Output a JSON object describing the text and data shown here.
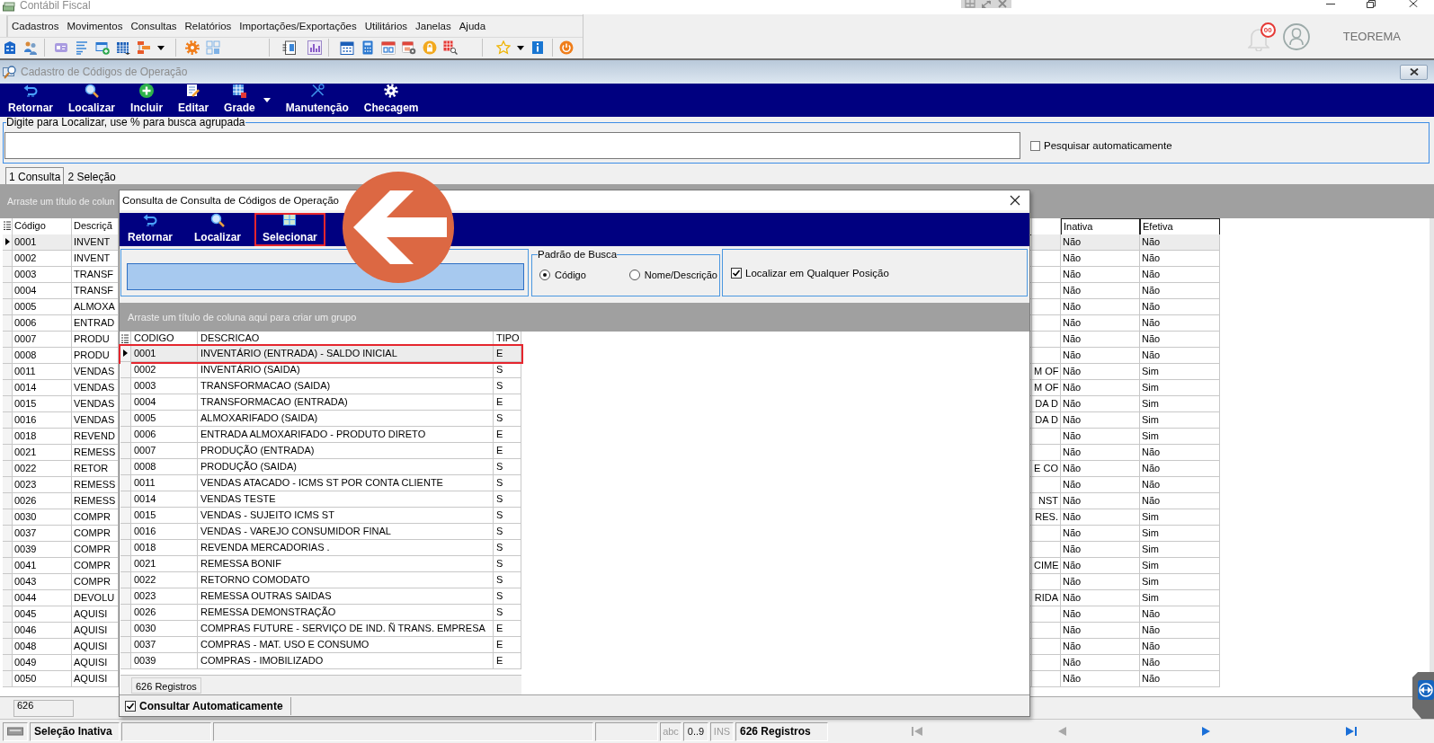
{
  "window": {
    "title": "Contábil Fiscal"
  },
  "menu": [
    "Cadastros",
    "Movimentos",
    "Consultas",
    "Relatórios",
    "Importações/Exportações",
    "Utilitários",
    "Janelas",
    "Ajuda"
  ],
  "user_area": {
    "notification_count": "00",
    "user_name": "TEOREMA"
  },
  "child_window": {
    "title": "Cadastro de Códigos de Operação",
    "toolbar": [
      {
        "label": "Retornar",
        "has_menu": false
      },
      {
        "label": "Localizar",
        "has_menu": false
      },
      {
        "label": "Incluir",
        "has_menu": false
      },
      {
        "label": "Editar",
        "has_menu": false
      },
      {
        "label": "Grade",
        "has_menu": true
      },
      {
        "label": "Manutenção",
        "has_menu": false
      },
      {
        "label": "Checagem",
        "has_menu": false
      }
    ],
    "search": {
      "legend": "Digite para Localizar, use % para busca agrupada"
    },
    "auto_search": {
      "label": "Pesquisar automaticamente",
      "checked": false
    },
    "tabs": [
      {
        "label": "1 Consulta",
        "selected": true
      },
      {
        "label": "2 Seleção",
        "selected": false
      }
    ],
    "group_hint": "Arraste um título de colun",
    "table": {
      "columns": [
        "Código",
        "Descriçã",
        "Inativa",
        "Efetiva"
      ],
      "rows": [
        {
          "codigo": "0001",
          "descricao": "INVENT",
          "inativa": "Não",
          "efetiva": "Não",
          "selected": true
        },
        {
          "codigo": "0002",
          "descricao": "INVENT",
          "inativa": "Não",
          "efetiva": "Não",
          "selected": false
        },
        {
          "codigo": "0003",
          "descricao": "TRANSF",
          "inativa": "Não",
          "efetiva": "Não",
          "selected": false
        },
        {
          "codigo": "0004",
          "descricao": "TRANSF",
          "inativa": "Não",
          "efetiva": "Não",
          "selected": false
        },
        {
          "codigo": "0005",
          "descricao": "ALMOXA",
          "inativa": "Não",
          "efetiva": "Não",
          "selected": false
        },
        {
          "codigo": "0006",
          "descricao": "ENTRAD",
          "inativa": "Não",
          "efetiva": "Não",
          "selected": false
        },
        {
          "codigo": "0007",
          "descricao": "PRODU",
          "inativa": "Não",
          "efetiva": "Não",
          "selected": false
        },
        {
          "codigo": "0008",
          "descricao": "PRODU",
          "inativa": "Não",
          "efetiva": "Não",
          "selected": false
        },
        {
          "codigo": "0011",
          "descricao": "VENDAS",
          "column_3": "M OF",
          "inativa": "Não",
          "efetiva": "Sim",
          "selected": false
        },
        {
          "codigo": "0014",
          "descricao": "VENDAS",
          "column_3": "M OF",
          "inativa": "Não",
          "efetiva": "Sim",
          "selected": false
        },
        {
          "codigo": "0015",
          "descricao": "VENDAS",
          "column_3": "DA D",
          "inativa": "Não",
          "efetiva": "Sim",
          "selected": false
        },
        {
          "codigo": "0016",
          "descricao": "VENDAS",
          "column_3": "DA D",
          "inativa": "Não",
          "efetiva": "Sim",
          "selected": false
        },
        {
          "codigo": "0018",
          "descricao": "REVEND",
          "inativa": "Não",
          "efetiva": "Sim",
          "selected": false
        },
        {
          "codigo": "0021",
          "descricao": "REMESS",
          "inativa": "Não",
          "efetiva": "Não",
          "selected": false
        },
        {
          "codigo": "0022",
          "descricao": "RETOR",
          "column_3": "E CO",
          "inativa": "Não",
          "efetiva": "Não",
          "selected": false
        },
        {
          "codigo": "0023",
          "descricao": "REMESS",
          "inativa": "Não",
          "efetiva": "Não",
          "selected": false
        },
        {
          "codigo": "0026",
          "descricao": "REMESS",
          "column_3": "NST",
          "inativa": "Não",
          "efetiva": "Não",
          "selected": false
        },
        {
          "codigo": "0030",
          "descricao": "COMPR",
          "column_3": "RES.",
          "inativa": "Não",
          "efetiva": "Sim",
          "selected": false
        },
        {
          "codigo": "0037",
          "descricao": "COMPR",
          "inativa": "Não",
          "efetiva": "Sim",
          "selected": false
        },
        {
          "codigo": "0039",
          "descricao": "COMPR",
          "inativa": "Não",
          "efetiva": "Sim",
          "selected": false
        },
        {
          "codigo": "0041",
          "descricao": "COMPR",
          "column_3": "CIME",
          "inativa": "Não",
          "efetiva": "Sim",
          "selected": false
        },
        {
          "codigo": "0043",
          "descricao": "COMPR",
          "inativa": "Não",
          "efetiva": "Sim",
          "selected": false
        },
        {
          "codigo": "0044",
          "descricao": "DEVOLU",
          "column_3": "RIDA",
          "inativa": "Não",
          "efetiva": "Sim",
          "selected": false
        },
        {
          "codigo": "0045",
          "descricao": "AQUISI",
          "inativa": "Não",
          "efetiva": "Não",
          "selected": false
        },
        {
          "codigo": "0046",
          "descricao": "AQUISI",
          "inativa": "Não",
          "efetiva": "Não",
          "selected": false
        },
        {
          "codigo": "0048",
          "descricao": "AQUISI",
          "inativa": "Não",
          "efetiva": "Não",
          "selected": false
        },
        {
          "codigo": "0049",
          "descricao": "AQUISI",
          "inativa": "Não",
          "efetiva": "Não",
          "selected": false
        },
        {
          "codigo": "0050",
          "descricao": "AQUISI",
          "inativa": "Não",
          "efetiva": "Não",
          "selected": false
        }
      ]
    },
    "footer_count": "626"
  },
  "dialog": {
    "title": "Consulta de Consulta de Códigos de Operação",
    "toolbar": [
      {
        "label": "Retornar",
        "highlighted": false
      },
      {
        "label": "Localizar",
        "highlighted": false
      },
      {
        "label": "Selecionar",
        "highlighted": true
      }
    ],
    "callout_arrow": true,
    "search": {
      "focused": true
    },
    "search_mode": {
      "legend": "Padrão de Busca",
      "options": [
        {
          "label": "Código",
          "selected": true
        },
        {
          "label": "Nome/Descrição",
          "selected": false
        }
      ]
    },
    "any_position": {
      "label": "Localizar em Qualquer Posição",
      "checked": true
    },
    "group_hint": "Arraste um título de coluna aqui para criar um grupo",
    "table": {
      "columns": [
        "CODIGO",
        "DESCRICAO",
        "TIPO"
      ],
      "rows": [
        {
          "codigo": "0001",
          "descricao": "INVENTÁRIO (ENTRADA) - SALDO INICIAL",
          "tipo": "E",
          "selected": true,
          "highlighted": true
        },
        {
          "codigo": "0002",
          "descricao": "INVENTÁRIO (SAIDA)",
          "tipo": "S",
          "selected": false,
          "highlighted": false
        },
        {
          "codigo": "0003",
          "descricao": "TRANSFORMACAO (SAIDA)",
          "tipo": "S",
          "selected": false,
          "highlighted": false
        },
        {
          "codigo": "0004",
          "descricao": "TRANSFORMACAO (ENTRADA)",
          "tipo": "E",
          "selected": false,
          "highlighted": false
        },
        {
          "codigo": "0005",
          "descricao": "ALMOXARIFADO (SAIDA)",
          "tipo": "S",
          "selected": false,
          "highlighted": false
        },
        {
          "codigo": "0006",
          "descricao": "ENTRADA ALMOXARIFADO - PRODUTO DIRETO",
          "tipo": "E",
          "selected": false,
          "highlighted": false
        },
        {
          "codigo": "0007",
          "descricao": "PRODUÇÃO (ENTRADA)",
          "tipo": "E",
          "selected": false,
          "highlighted": false
        },
        {
          "codigo": "0008",
          "descricao": "PRODUÇÃO (SAIDA)",
          "tipo": "S",
          "selected": false,
          "highlighted": false
        },
        {
          "codigo": "0011",
          "descricao": "VENDAS ATACADO - ICMS ST POR CONTA CLIENTE",
          "tipo": "S",
          "selected": false,
          "highlighted": false
        },
        {
          "codigo": "0014",
          "descricao": "VENDAS TESTE",
          "tipo": "S",
          "selected": false,
          "highlighted": false
        },
        {
          "codigo": "0015",
          "descricao": "VENDAS - SUJEITO ICMS ST",
          "tipo": "S",
          "selected": false,
          "highlighted": false
        },
        {
          "codigo": "0016",
          "descricao": "VENDAS - VAREJO CONSUMIDOR FINAL",
          "tipo": "S",
          "selected": false,
          "highlighted": false
        },
        {
          "codigo": "0018",
          "descricao": "REVENDA MERCADORIAS .",
          "tipo": "S",
          "selected": false,
          "highlighted": false
        },
        {
          "codigo": "0021",
          "descricao": "REMESSA BONIF",
          "tipo": "S",
          "selected": false,
          "highlighted": false
        },
        {
          "codigo": "0022",
          "descricao": "RETORNO COMODATO",
          "tipo": "S",
          "selected": false,
          "highlighted": false
        },
        {
          "codigo": "0023",
          "descricao": "REMESSA OUTRAS SAIDAS",
          "tipo": "S",
          "selected": false,
          "highlighted": false
        },
        {
          "codigo": "0026",
          "descricao": "REMESSA DEMONSTRAÇÃO",
          "tipo": "S",
          "selected": false,
          "highlighted": false
        },
        {
          "codigo": "0030",
          "descricao": "COMPRAS FUTURE - SERVIÇO DE IND. Ñ TRANS. EMPRESA",
          "tipo": "E",
          "selected": false,
          "highlighted": false
        },
        {
          "codigo": "0037",
          "descricao": "COMPRAS - MAT. USO E CONSUMO",
          "tipo": "E",
          "selected": false,
          "highlighted": false
        },
        {
          "codigo": "0039",
          "descricao": "COMPRAS - IMOBILIZADO",
          "tipo": "E",
          "selected": false,
          "highlighted": false
        }
      ]
    },
    "footer_count": "626 Registros",
    "auto_query": {
      "label": "Consultar Automaticamente",
      "checked": true
    }
  },
  "status_bar": {
    "selection": "Seleção Inativa",
    "indicators": [
      {
        "label": "abc",
        "on": false
      },
      {
        "label": "0..9",
        "on": true
      },
      {
        "label": "INS",
        "on": false
      }
    ],
    "records": "626 Registros",
    "navigation": [
      {
        "disabled": true
      },
      {
        "disabled": true
      },
      {
        "disabled": false
      },
      {
        "disabled": false
      }
    ]
  }
}
